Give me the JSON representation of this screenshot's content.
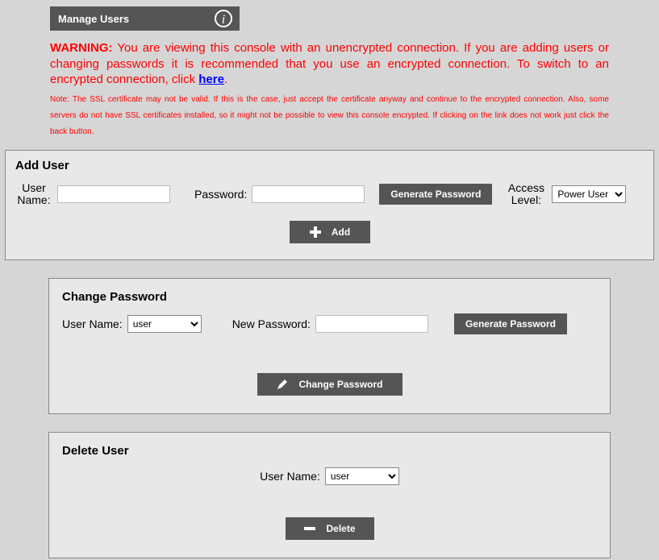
{
  "banner": {
    "title": "Manage Users"
  },
  "warning": {
    "label": "WARNING:",
    "text": "You are viewing this console with an unencrypted connection. If you are adding users or changing passwords it is recommended that you use an encrypted connection. To switch to an encrypted connection, click ",
    "link": "here",
    "after": "."
  },
  "note": {
    "text": "Note: The SSL certificate may not be valid. If this is the case, just accept the certificate anyway and continue to the encrypted connection. Also, some servers do not have SSL certificates installed, so it might not be possible to view this console encrypted. If clicking on the link does not work just click the back button."
  },
  "addUser": {
    "title": "Add User",
    "username_label": "User Name:",
    "username_value": "",
    "password_label": "Password:",
    "password_value": "",
    "generate_label": "Generate Password",
    "access_label": "Access Level:",
    "access_value": "Power User",
    "access_options": [
      "Power User"
    ],
    "add_label": "Add"
  },
  "changePassword": {
    "title": "Change Password",
    "username_label": "User Name:",
    "username_value": "user",
    "username_options": [
      "user"
    ],
    "newpassword_label": "New Password:",
    "newpassword_value": "",
    "generate_label": "Generate Password",
    "button_label": "Change Password"
  },
  "deleteUser": {
    "title": "Delete User",
    "username_label": "User Name:",
    "username_value": "user",
    "username_options": [
      "user"
    ],
    "button_label": "Delete"
  }
}
